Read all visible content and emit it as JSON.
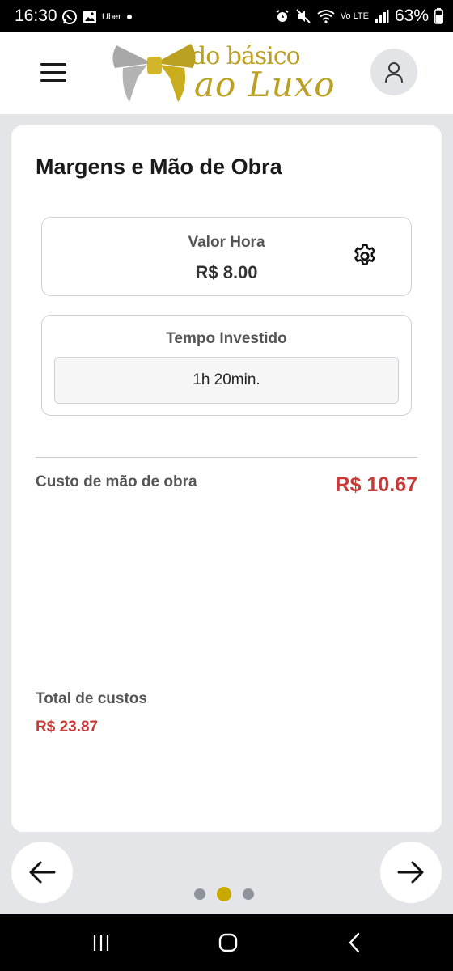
{
  "status_bar": {
    "time": "16:30",
    "left_icons": [
      "whatsapp-icon",
      "gallery-icon",
      "uber-icon",
      "dot-icon"
    ],
    "uber_label": "Uber",
    "right_icons": [
      "alarm-icon",
      "mute-icon",
      "wifi-icon",
      "volte-icon",
      "signal-icon",
      "battery-icon"
    ],
    "volte_label": "Vo LTE",
    "battery": "63%"
  },
  "header": {
    "logo_line1": "do básico",
    "logo_line2": "ao Luxo",
    "brand_color": "#bba022"
  },
  "card": {
    "title": "Margens e Mão de Obra",
    "valor_hora": {
      "label": "Valor Hora",
      "value": "R$ 8.00"
    },
    "tempo_investido": {
      "label": "Tempo Investido",
      "value": "1h 20min."
    },
    "labor_cost": {
      "label": "Custo de mão de obra",
      "value": "R$ 10.67"
    },
    "total_costs": {
      "label": "Total de custos",
      "value": "R$ 23.87"
    }
  },
  "pagination": {
    "pages": 3,
    "current": 2,
    "active_color": "#c9a800"
  },
  "colors": {
    "accent_red": "#c83a36",
    "background": "#e4e5e9"
  }
}
